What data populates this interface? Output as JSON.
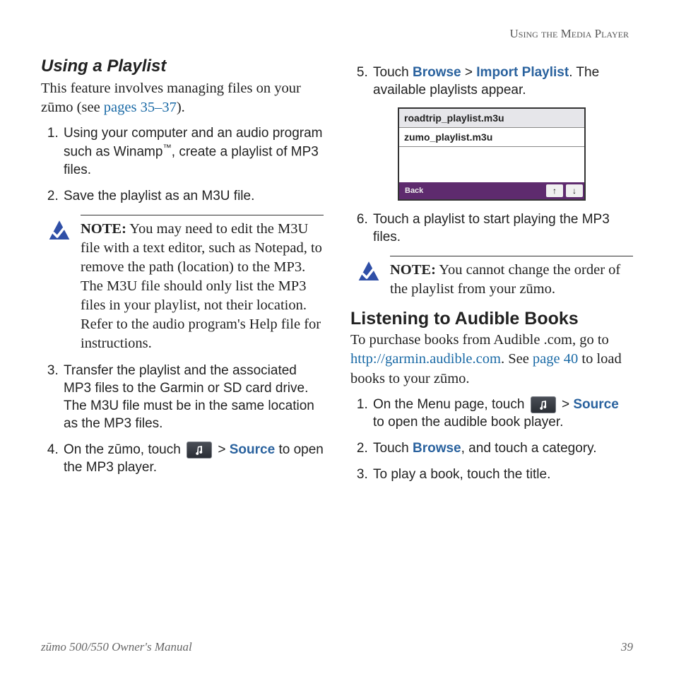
{
  "running_head": "Using the Media Player",
  "left": {
    "title": "Using a Playlist",
    "intro_pre": "This feature involves managing files on your zūmo (see ",
    "intro_link": "pages 35–37",
    "intro_post": ").",
    "step1_a": "Using your computer and an audio program such as Winamp",
    "step1_tm": "™",
    "step1_b": ", create a playlist of MP3 files.",
    "step2": "Save the playlist as an M3U file.",
    "note_label": "NOTE:",
    "note_body": " You may need to edit the M3U file with a text editor, such as Notepad, to remove the path (location) to the MP3. The M3U file should only list the MP3 files in your playlist, not their location. Refer to the audio program's Help file for instructions.",
    "step3": "Transfer the playlist and the associated MP3 files to the Garmin or SD card drive. The M3U file must be in the same location as the MP3 files.",
    "step4_a": "On the zūmo, touch ",
    "step4_gt": " > ",
    "step4_source": "Source",
    "step4_b": " to open the MP3 player."
  },
  "right": {
    "step5_a": "Touch ",
    "step5_browse": "Browse",
    "step5_gt": " > ",
    "step5_import": "Import Playlist",
    "step5_b": ". The available playlists appear.",
    "playlist_items": {
      "0": "roadtrip_playlist.m3u",
      "1": "zumo_playlist.m3u"
    },
    "back_label": "Back",
    "step6": "Touch a playlist to start playing the MP3 files.",
    "note_label": "NOTE:",
    "note_body": " You cannot change the order of the playlist from your zūmo.",
    "h2": "Listening to Audible Books",
    "audible_a": "To purchase books from Audible .com, go to ",
    "audible_link": "http://garmin.audible.com",
    "audible_b": ". See ",
    "audible_link2": "page 40",
    "audible_c": " to load books to your zūmo.",
    "astep1_a": "On the Menu page, touch ",
    "astep1_gt": " > ",
    "astep1_source": "Source",
    "astep1_b": " to open the audible book player.",
    "astep2_a": "Touch ",
    "astep2_browse": "Browse",
    "astep2_b": ", and touch a category.",
    "astep3": "To play a book, touch the title."
  },
  "footer": {
    "left": "zūmo 500/550 Owner's Manual",
    "right": "39"
  }
}
